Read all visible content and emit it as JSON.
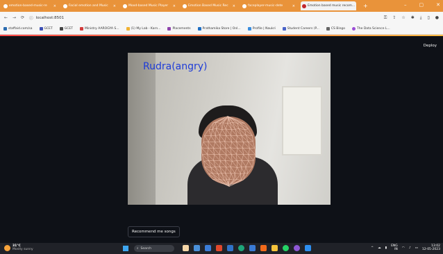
{
  "browser": {
    "tabs": [
      {
        "label": "emotion-based-music-re"
      },
      {
        "label": "Facial emotion and Music"
      },
      {
        "label": "Mood-based Music Player"
      },
      {
        "label": "Emotion Based Music Rec"
      },
      {
        "label": "faceplayer-music-dete"
      },
      {
        "label": "Emotion based music recom...",
        "active": true
      }
    ],
    "address": "localhost:8501",
    "bookmarks": [
      "staffaid.com/sa",
      "GCET",
      "GCET",
      "Ministry AAROGYA S...",
      "(1) My Lab - Karn...",
      "Placements",
      "Prathamika Store | Onl...",
      "Profile | Naukri",
      "Student Careers (P...",
      "CS Bingo",
      "The Data Science L..."
    ]
  },
  "app": {
    "deploy_label": "Deploy",
    "emotion_label": "Rudra(angry)",
    "recommend_button": "Recommend me songs"
  },
  "taskbar": {
    "weather_temp": "31°C",
    "weather_desc": "Mostly sunny",
    "search_placeholder": "Search",
    "lang": "ENG",
    "region": "IN",
    "time": "13:02",
    "date": "12-05-2023"
  },
  "colors": {
    "tabbar": "#e9933a",
    "app_background": "#0e1117",
    "emotion_text": "#1e3cd8",
    "mesh_lines": "#f3cbb8"
  }
}
